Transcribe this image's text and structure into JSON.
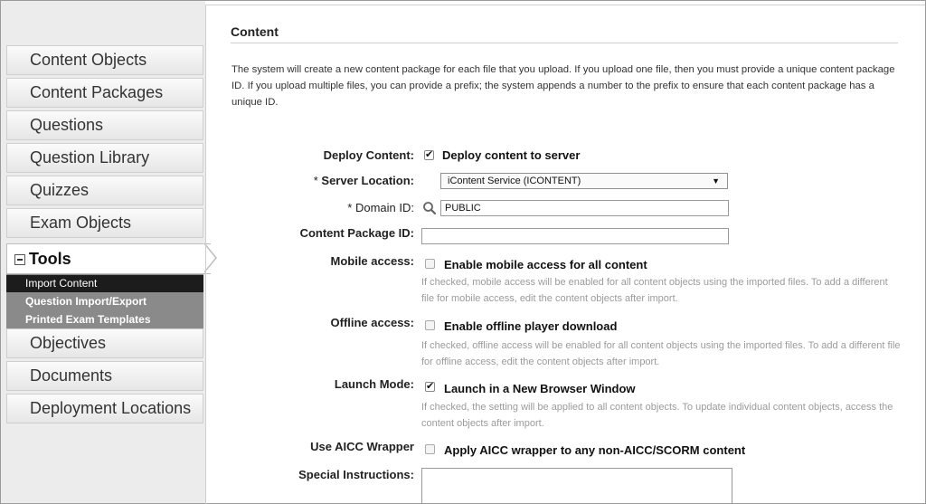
{
  "sidebar": {
    "items_top": [
      "Content Objects",
      "Content Packages",
      "Questions",
      "Question Library",
      "Quizzes",
      "Exam Objects"
    ],
    "tools_label": "Tools",
    "tools_submenu": [
      "Import Content",
      "Question Import/Export",
      "Printed Exam Templates"
    ],
    "items_bottom": [
      "Objectives",
      "Documents",
      "Deployment Locations"
    ]
  },
  "content": {
    "title": "Content",
    "intro": "The system will create a new content package for each file that you upload. If you upload one file, then you must provide a unique content package ID. If you upload multiple files, you can provide a prefix; the system appends a number to the prefix to ensure that each content package has a unique ID.",
    "deploy_label": "Deploy Content:",
    "deploy_option": "Deploy content to server",
    "server_label": "Server Location:",
    "required_mark": "*",
    "server_value": "iContent Service (ICONTENT)",
    "domain_label": "Domain ID:",
    "domain_value": "PUBLIC",
    "package_label": "Content Package ID:",
    "package_value": "",
    "mobile_label": "Mobile access:",
    "mobile_option": "Enable mobile access for all content",
    "mobile_help": "If checked, mobile access will be enabled for all content objects using the imported files. To add a different file for mobile access, edit the content objects after import.",
    "offline_label": "Offline access:",
    "offline_option": "Enable offline player download",
    "offline_help": "If checked, offline access will be enabled for all content objects using the imported files. To add a different file for offline access, edit the content objects after import.",
    "launch_label": "Launch Mode:",
    "launch_option": "Launch in a New Browser Window",
    "launch_help": "If checked, the setting will be applied to all content objects. To update individual content objects, access the content objects after import.",
    "aicc_label": "Use AICC Wrapper",
    "aicc_option": "Apply AICC wrapper to any non-AICC/SCORM content",
    "instructions_label": "Special Instructions:"
  },
  "state": {
    "deploy_checked": true,
    "mobile_checked": false,
    "offline_checked": false,
    "launch_checked": true,
    "aicc_checked": false
  }
}
